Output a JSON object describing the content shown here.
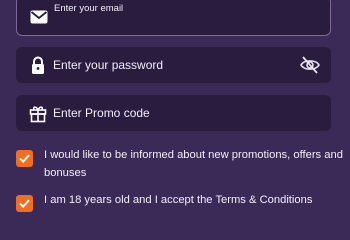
{
  "form": {
    "email": {
      "placeholder": "Enter your email",
      "value": "",
      "icon": "envelope-icon"
    },
    "password": {
      "placeholder": "Enter your password",
      "value": "",
      "icon": "lock-icon",
      "toggle_icon": "eye-off-icon"
    },
    "promo": {
      "placeholder": "Enter Promo code",
      "value": "",
      "icon": "gift-icon"
    },
    "checkboxes": [
      {
        "label": "I would like to be informed about new promotions, offers and bonuses",
        "checked": true
      },
      {
        "label": "I am 18 years old and I accept the Terms & Conditions",
        "checked": true
      }
    ]
  },
  "colors": {
    "background": "#3b2957",
    "field": "#291c3f",
    "accent": "#f16d1f",
    "text": "#f2eef8"
  }
}
